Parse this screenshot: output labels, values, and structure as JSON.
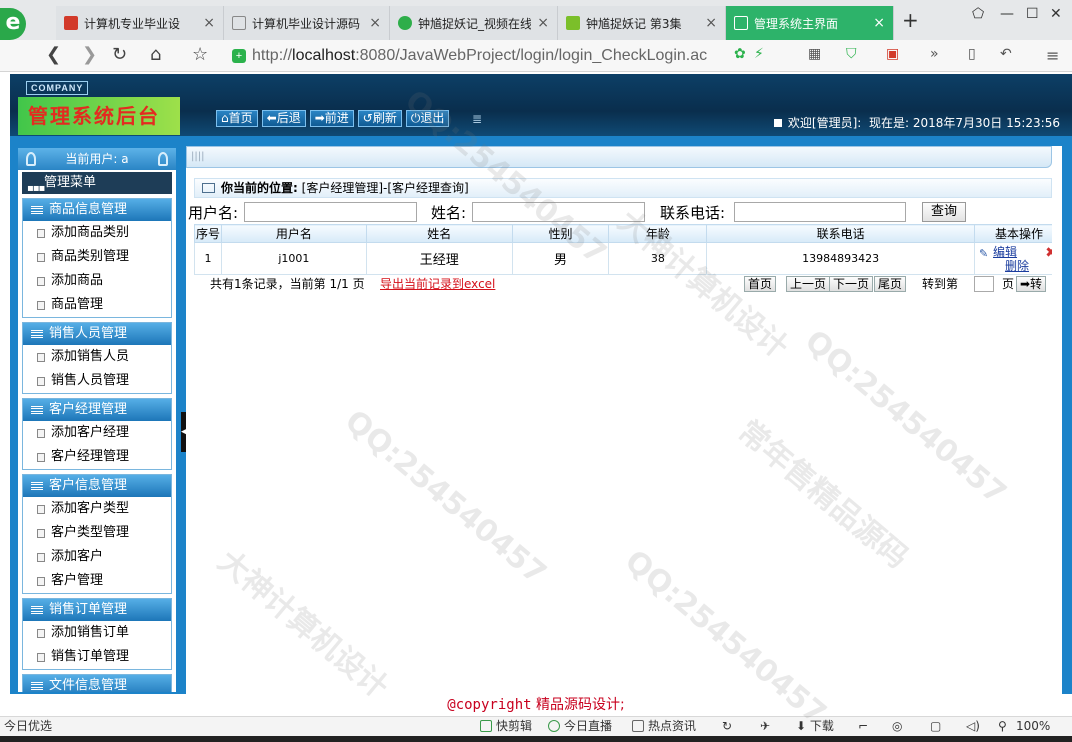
{
  "browser": {
    "tabs": [
      {
        "label": "计算机专业毕业设",
        "icon_color": "#d23a2a"
      },
      {
        "label": "计算机毕业设计源码",
        "icon_color": "#888888"
      },
      {
        "label": "钟馗捉妖记_视频在线",
        "icon_color": "#2eae4a"
      },
      {
        "label": "钟馗捉妖记 第3集",
        "icon_color": "#7bbf2a"
      },
      {
        "label": "管理系统主界面",
        "icon_color": "#ffffff"
      }
    ],
    "url_host": "localhost",
    "url_rest": ":8080/JavaWebProject/login/login_CheckLogin.ac",
    "new_tab": "+",
    "accent": "#2db36a"
  },
  "header": {
    "company": "COMPANY",
    "title": "管理系统后台",
    "buttons": [
      "首页",
      "后退",
      "前进",
      "刷新",
      "退出"
    ],
    "button_icons": [
      "home-icon",
      "back-arrow-icon",
      "forward-arrow-icon",
      "refresh-icon",
      "power-icon"
    ],
    "welcome": "欢迎[管理员]:",
    "time_label": "现在是:",
    "time_value": "2018年7月30日 15:23:56"
  },
  "sidebar": {
    "current_user": "当前用户: a",
    "menu_title": "管理菜单",
    "groups": [
      {
        "title": "商品信息管理",
        "items": [
          "添加商品类别",
          "商品类别管理",
          "添加商品",
          "商品管理"
        ]
      },
      {
        "title": "销售人员管理",
        "items": [
          "添加销售人员",
          "销售人员管理"
        ]
      },
      {
        "title": "客户经理管理",
        "items": [
          "添加客户经理",
          "客户经理管理"
        ]
      },
      {
        "title": "客户信息管理",
        "items": [
          "添加客户类型",
          "客户类型管理",
          "添加客户",
          "客户管理"
        ]
      },
      {
        "title": "销售订单管理",
        "items": [
          "添加销售订单",
          "销售订单管理"
        ]
      },
      {
        "title": "文件信息管理",
        "items": []
      }
    ]
  },
  "main": {
    "location_label": "你当前的位置:",
    "location_value": "[客户经理管理]-[客户经理查询]",
    "search": {
      "username_label": "用户名:",
      "username_value": "",
      "name_label": "姓名:",
      "name_value": "",
      "phone_label": "联系电话:",
      "phone_value": "",
      "query_button": "查询"
    },
    "table": {
      "headers": [
        "序号",
        "用户名",
        "姓名",
        "性别",
        "年龄",
        "联系电话",
        "基本操作"
      ],
      "rows": [
        {
          "index": "1",
          "username": "j1001",
          "name": "王经理",
          "gender": "男",
          "age": "38",
          "phone": "13984893423",
          "edit": "编辑",
          "delete": "删除"
        }
      ]
    },
    "pager": {
      "info": "共有1条记录，当前第 1/1 页",
      "export": "导出当前记录到excel",
      "first": "首页",
      "prev": "上一页",
      "next": "下一页",
      "last": "尾页",
      "goto": "转到第",
      "page_value": "",
      "page_unit": "页",
      "go": "➡转"
    }
  },
  "footer": {
    "prefix": "@copyright",
    "suffix": "精品源码设计;"
  },
  "statusbar": {
    "left": "今日优选",
    "items": [
      "快剪辑",
      "今日直播",
      "热点资讯"
    ],
    "download": "下载",
    "zoom": "100%"
  },
  "watermarks": [
    "QQ:254540457",
    "大神计算机设计",
    "常年售精品源码"
  ]
}
